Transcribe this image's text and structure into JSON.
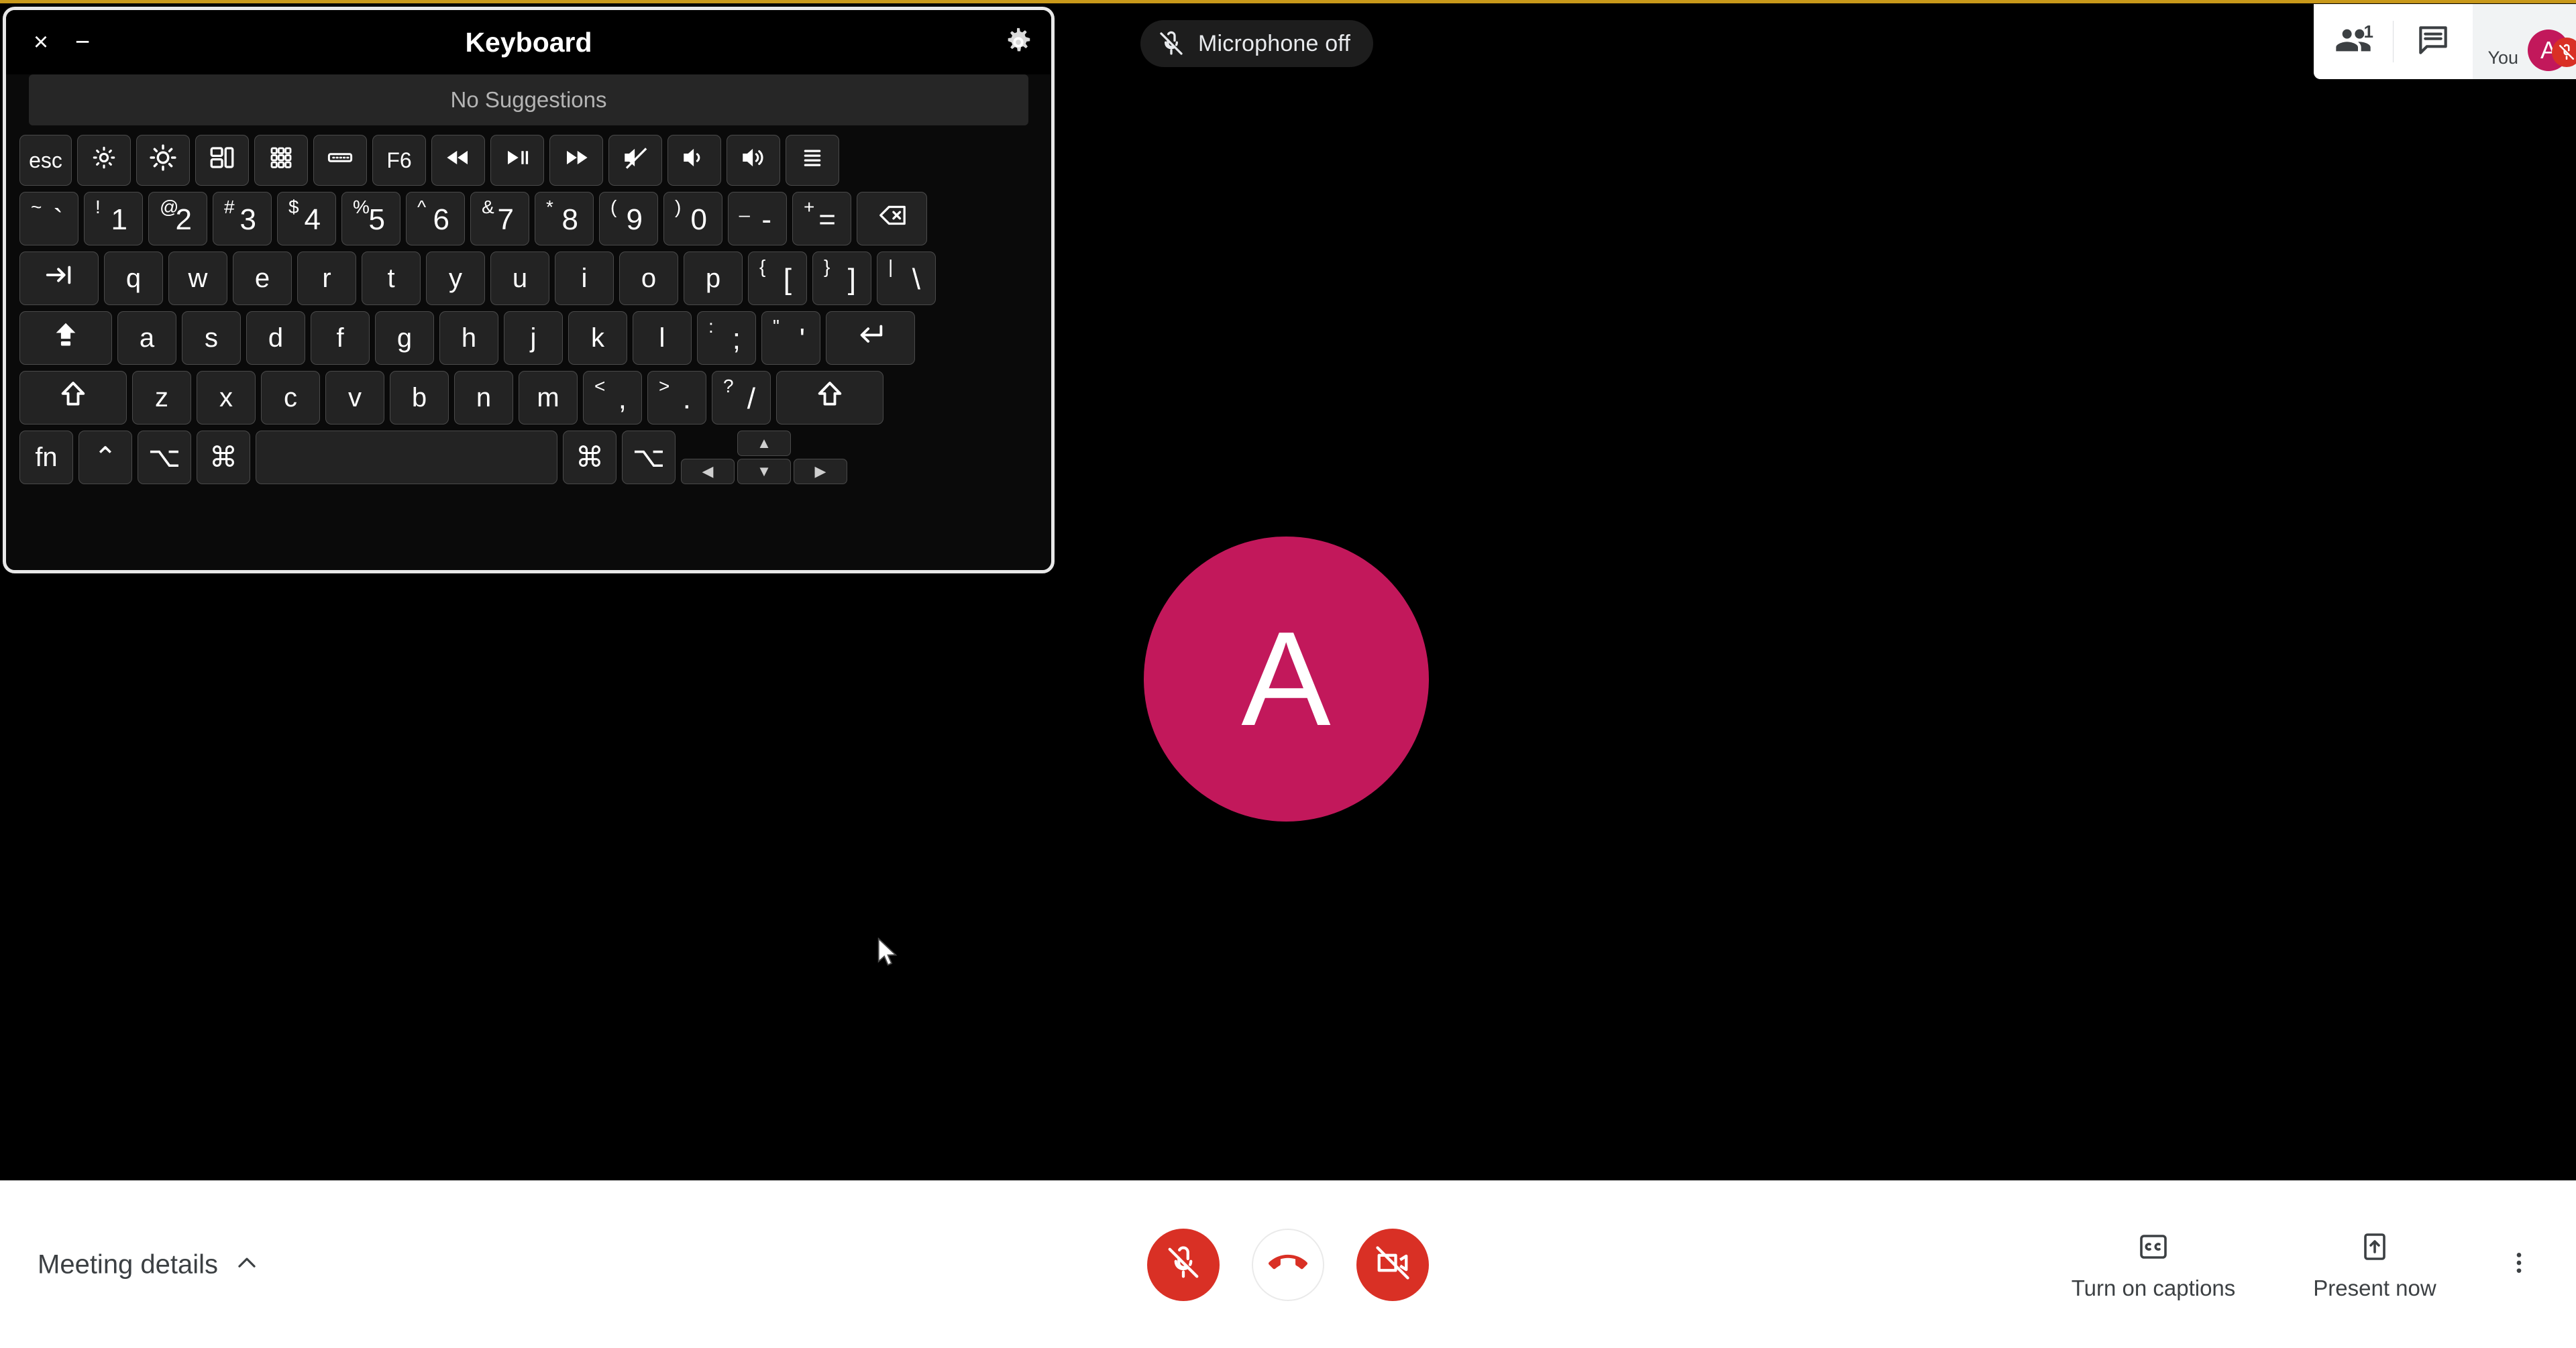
{
  "meet": {
    "mic_status_pill": {
      "label": "Microphone off",
      "icon": "mic-off-icon"
    },
    "topbar": {
      "people_icon": "people-icon",
      "people_count": "1",
      "chat_icon": "chat-icon",
      "you_label": "You",
      "you_avatar_initial": "A",
      "you_mic_badge_icon": "mic-off-icon"
    },
    "main_avatar_initial": "A",
    "accent_colors": {
      "avatar_pink": "#c2185b",
      "danger_red": "#d93025",
      "top_accent": "#c9991a"
    },
    "bottom_bar": {
      "meeting_details_label": "Meeting details",
      "meeting_details_chevron": "chevron-up-icon",
      "mic_button": {
        "name": "microphone-off-button",
        "icon": "mic-off-icon",
        "state": "off"
      },
      "hangup_button": {
        "name": "leave-call-button",
        "icon": "call-end-icon"
      },
      "camera_button": {
        "name": "camera-off-button",
        "icon": "videocam-off-icon",
        "state": "off"
      },
      "captions": {
        "label": "Turn on captions",
        "icon": "closed-caption-icon"
      },
      "present": {
        "label": "Present now",
        "icon": "present-to-all-icon"
      },
      "more_options": {
        "icon": "more-vert-icon"
      }
    }
  },
  "keyboard": {
    "title": "Keyboard",
    "close_label": "×",
    "minimize_label": "−",
    "settings_icon": "gear-icon",
    "suggestions_text": "No Suggestions",
    "rows": {
      "function": [
        {
          "type": "text",
          "label": "esc",
          "name": "key-esc",
          "w": "w-esc"
        },
        {
          "type": "icon",
          "icon": "brightness-down-icon",
          "name": "key-brightness-down",
          "w": "w-fk"
        },
        {
          "type": "icon",
          "icon": "brightness-up-icon",
          "name": "key-brightness-up",
          "w": "w-fk"
        },
        {
          "type": "icon",
          "icon": "mission-control-icon",
          "name": "key-mission-control",
          "w": "w-fk"
        },
        {
          "type": "icon",
          "icon": "launchpad-icon",
          "name": "key-launchpad",
          "w": "w-fk"
        },
        {
          "type": "icon",
          "icon": "keyboard-backlight-icon",
          "name": "key-keyboard-backlight",
          "w": "w-fk"
        },
        {
          "type": "text",
          "label": "F6",
          "name": "key-f6",
          "w": "w-fk"
        },
        {
          "type": "icon",
          "icon": "rewind-icon",
          "name": "key-rewind",
          "w": "w-fk"
        },
        {
          "type": "icon",
          "icon": "play-pause-icon",
          "name": "key-play-pause",
          "w": "w-fk"
        },
        {
          "type": "icon",
          "icon": "fast-forward-icon",
          "name": "key-fast-forward",
          "w": "w-fk"
        },
        {
          "type": "icon",
          "icon": "volume-mute-icon",
          "name": "key-mute",
          "w": "w-fk"
        },
        {
          "type": "icon",
          "icon": "volume-down-icon",
          "name": "key-volume-down",
          "w": "w-fk"
        },
        {
          "type": "icon",
          "icon": "volume-up-icon",
          "name": "key-volume-up",
          "w": "w-fk"
        },
        {
          "type": "icon",
          "icon": "control-center-icon",
          "name": "key-control-center",
          "w": "w-fk"
        }
      ],
      "numbers": [
        {
          "type": "dual",
          "shift": "~",
          "main": "`",
          "name": "key-backtick",
          "w": "w-num"
        },
        {
          "type": "dual",
          "shift": "!",
          "main": "1",
          "name": "key-1",
          "w": "w-num"
        },
        {
          "type": "dual",
          "shift": "@",
          "main": "2",
          "name": "key-2",
          "w": "w-num"
        },
        {
          "type": "dual",
          "shift": "#",
          "main": "3",
          "name": "key-3",
          "w": "w-num"
        },
        {
          "type": "dual",
          "shift": "$",
          "main": "4",
          "name": "key-4",
          "w": "w-num"
        },
        {
          "type": "dual",
          "shift": "%",
          "main": "5",
          "name": "key-5",
          "w": "w-num"
        },
        {
          "type": "dual",
          "shift": "^",
          "main": "6",
          "name": "key-6",
          "w": "w-num"
        },
        {
          "type": "dual",
          "shift": "&",
          "main": "7",
          "name": "key-7",
          "w": "w-num"
        },
        {
          "type": "dual",
          "shift": "*",
          "main": "8",
          "name": "key-8",
          "w": "w-num"
        },
        {
          "type": "dual",
          "shift": "(",
          "main": "9",
          "name": "key-9",
          "w": "w-num"
        },
        {
          "type": "dual",
          "shift": ")",
          "main": "0",
          "name": "key-0",
          "w": "w-num"
        },
        {
          "type": "dual",
          "shift": "_",
          "main": "-",
          "name": "key-minus",
          "w": "w-num"
        },
        {
          "type": "dual",
          "shift": "+",
          "main": "=",
          "name": "key-equals",
          "w": "w-num"
        },
        {
          "type": "icon",
          "icon": "backspace-icon",
          "name": "key-delete",
          "w": "w-bksp"
        }
      ],
      "top": [
        {
          "type": "icon",
          "icon": "tab-icon",
          "name": "key-tab",
          "w": "w-tab"
        },
        {
          "type": "text",
          "label": "q",
          "name": "key-q",
          "w": "w-ltr"
        },
        {
          "type": "text",
          "label": "w",
          "name": "key-w",
          "w": "w-ltr"
        },
        {
          "type": "text",
          "label": "e",
          "name": "key-e",
          "w": "w-ltr"
        },
        {
          "type": "text",
          "label": "r",
          "name": "key-r",
          "w": "w-ltr"
        },
        {
          "type": "text",
          "label": "t",
          "name": "key-t",
          "w": "w-ltr"
        },
        {
          "type": "text",
          "label": "y",
          "name": "key-y",
          "w": "w-ltr"
        },
        {
          "type": "text",
          "label": "u",
          "name": "key-u",
          "w": "w-ltr"
        },
        {
          "type": "text",
          "label": "i",
          "name": "key-i",
          "w": "w-ltr"
        },
        {
          "type": "text",
          "label": "o",
          "name": "key-o",
          "w": "w-ltr"
        },
        {
          "type": "text",
          "label": "p",
          "name": "key-p",
          "w": "w-ltr"
        },
        {
          "type": "dual",
          "shift": "{",
          "main": "[",
          "name": "key-bracket-left",
          "w": "w-ltr"
        },
        {
          "type": "dual",
          "shift": "}",
          "main": "]",
          "name": "key-bracket-right",
          "w": "w-ltr"
        },
        {
          "type": "dual",
          "shift": "|",
          "main": "\\",
          "name": "key-backslash",
          "w": "w-ltr"
        }
      ],
      "home": [
        {
          "type": "icon",
          "icon": "caps-lock-icon",
          "name": "key-caps-lock",
          "w": "w-caps"
        },
        {
          "type": "text",
          "label": "a",
          "name": "key-a",
          "w": "w-ltr"
        },
        {
          "type": "text",
          "label": "s",
          "name": "key-s",
          "w": "w-ltr"
        },
        {
          "type": "text",
          "label": "d",
          "name": "key-d",
          "w": "w-ltr"
        },
        {
          "type": "text",
          "label": "f",
          "name": "key-f",
          "w": "w-ltr"
        },
        {
          "type": "text",
          "label": "g",
          "name": "key-g",
          "w": "w-ltr"
        },
        {
          "type": "text",
          "label": "h",
          "name": "key-h",
          "w": "w-ltr"
        },
        {
          "type": "text",
          "label": "j",
          "name": "key-j",
          "w": "w-ltr"
        },
        {
          "type": "text",
          "label": "k",
          "name": "key-k",
          "w": "w-ltr"
        },
        {
          "type": "text",
          "label": "l",
          "name": "key-l",
          "w": "w-ltr"
        },
        {
          "type": "dual",
          "shift": ":",
          "main": ";",
          "name": "key-semicolon",
          "w": "w-ltr"
        },
        {
          "type": "dual",
          "shift": "\"",
          "main": "'",
          "name": "key-quote",
          "w": "w-ltr"
        },
        {
          "type": "icon",
          "icon": "return-icon",
          "name": "key-return",
          "w": "w-ret"
        }
      ],
      "bottom": [
        {
          "type": "icon",
          "icon": "shift-icon",
          "name": "key-shift-left",
          "w": "w-lshift"
        },
        {
          "type": "text",
          "label": "z",
          "name": "key-z",
          "w": "w-ltr"
        },
        {
          "type": "text",
          "label": "x",
          "name": "key-x",
          "w": "w-ltr"
        },
        {
          "type": "text",
          "label": "c",
          "name": "key-c",
          "w": "w-ltr"
        },
        {
          "type": "text",
          "label": "v",
          "name": "key-v",
          "w": "w-ltr"
        },
        {
          "type": "text",
          "label": "b",
          "name": "key-b",
          "w": "w-ltr"
        },
        {
          "type": "text",
          "label": "n",
          "name": "key-n",
          "w": "w-ltr"
        },
        {
          "type": "text",
          "label": "m",
          "name": "key-m",
          "w": "w-ltr"
        },
        {
          "type": "dual",
          "shift": "<",
          "main": ",",
          "name": "key-comma",
          "w": "w-ltr"
        },
        {
          "type": "dual",
          "shift": ">",
          "main": ".",
          "name": "key-period",
          "w": "w-ltr"
        },
        {
          "type": "dual",
          "shift": "?",
          "main": "/",
          "name": "key-slash",
          "w": "w-ltr"
        },
        {
          "type": "icon",
          "icon": "shift-icon",
          "name": "key-shift-right",
          "w": "w-rshift"
        }
      ],
      "modifier": [
        {
          "type": "text",
          "label": "fn",
          "name": "key-fn",
          "w": "w-mod"
        },
        {
          "type": "glyph",
          "label": "⌃",
          "name": "key-control",
          "w": "w-mod"
        },
        {
          "type": "glyph",
          "label": "⌥",
          "name": "key-option-left",
          "w": "w-mod"
        },
        {
          "type": "glyph",
          "label": "⌘",
          "name": "key-command-left",
          "w": "w-mod"
        },
        {
          "type": "text",
          "label": "",
          "name": "key-space",
          "w": "w-space"
        },
        {
          "type": "glyph",
          "label": "⌘",
          "name": "key-command-right",
          "w": "w-mod"
        },
        {
          "type": "glyph",
          "label": "⌥",
          "name": "key-option-right",
          "w": "w-mod"
        }
      ],
      "arrows": {
        "up": {
          "label": "▲",
          "name": "key-arrow-up"
        },
        "left": {
          "label": "◀",
          "name": "key-arrow-left"
        },
        "down": {
          "label": "▼",
          "name": "key-arrow-down"
        },
        "right": {
          "label": "▶",
          "name": "key-arrow-right"
        }
      }
    }
  }
}
